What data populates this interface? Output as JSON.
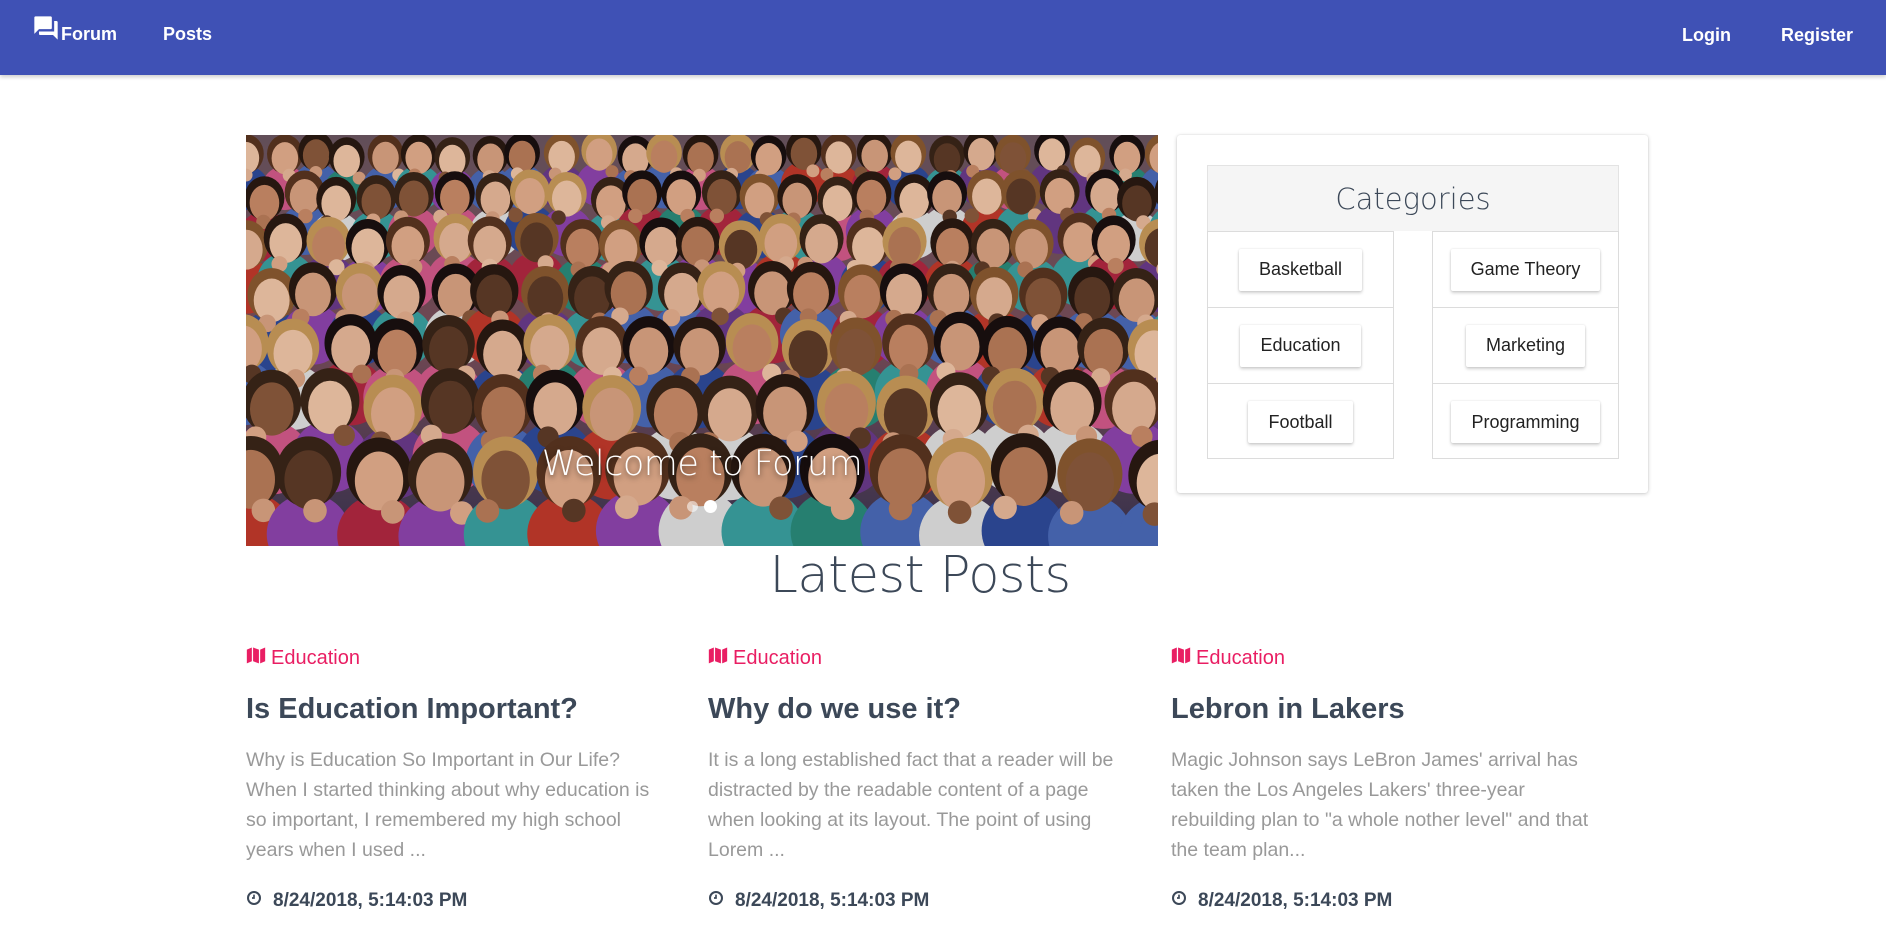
{
  "navbar": {
    "brand": "Forum",
    "links": {
      "posts": "Posts",
      "login": "Login",
      "register": "Register"
    },
    "background": "#3f51b5"
  },
  "hero": {
    "caption": "Welcome to Forum",
    "slides": 2,
    "active_slide": 2
  },
  "categories": {
    "title": "Categories",
    "left": [
      "Basketball",
      "Education",
      "Football"
    ],
    "right": [
      "Game Theory",
      "Marketing",
      "Programming"
    ]
  },
  "latest": {
    "title": "Latest Posts",
    "posts": [
      {
        "category": "Education",
        "title": "Is Education Important?",
        "excerpt": "Why is Education So Important in Our Life? When I started thinking about why education is so important, I remembered my high school years when I used ...",
        "date": "8/24/2018, 5:14:03 PM"
      },
      {
        "category": "Education",
        "title": "Why do we use it?",
        "excerpt": "It is a long established fact that a reader will be distracted by the readable content of a page when looking at its layout. The point of using Lorem ...",
        "date": "8/24/2018, 5:14:03 PM"
      },
      {
        "category": "Education",
        "title": "Lebron in Lakers",
        "excerpt": "Magic Johnson says LeBron James' arrival has taken the Los Angeles Lakers' three-year rebuilding plan to \"a whole nother level\" and that the team plan...",
        "date": "8/24/2018, 5:14:03 PM"
      }
    ]
  },
  "colors": {
    "accent": "#e91e63",
    "text_dark": "#3c4858",
    "text_muted": "#999999"
  },
  "icons": {
    "brand": "forum-icon",
    "category": "map-icon",
    "date": "clock-icon"
  }
}
